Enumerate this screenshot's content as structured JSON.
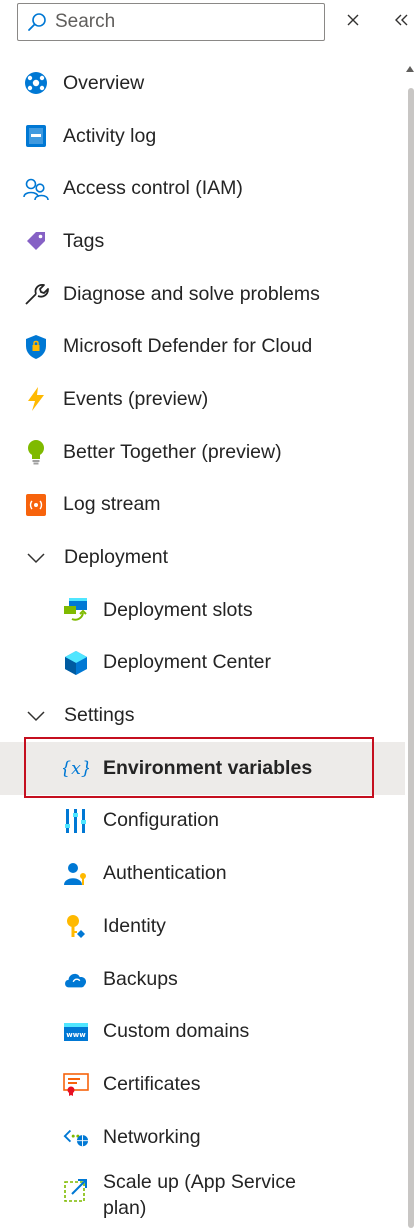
{
  "search": {
    "placeholder": "Search"
  },
  "toolbar": {
    "clear_icon": "close-icon",
    "collapse_icon": "double-chevron-left-icon"
  },
  "menu": {
    "items": [
      {
        "label": "Overview",
        "icon": "overview-icon"
      },
      {
        "label": "Activity log",
        "icon": "activity-log-icon"
      },
      {
        "label": "Access control (IAM)",
        "icon": "people-icon"
      },
      {
        "label": "Tags",
        "icon": "tag-icon"
      },
      {
        "label": "Diagnose and solve problems",
        "icon": "wrench-icon"
      },
      {
        "label": "Microsoft Defender for Cloud",
        "icon": "shield-icon"
      },
      {
        "label": "Events (preview)",
        "icon": "lightning-icon"
      },
      {
        "label": "Better Together (preview)",
        "icon": "lightbulb-icon"
      },
      {
        "label": "Log stream",
        "icon": "log-stream-icon"
      }
    ],
    "deployment": {
      "label": "Deployment",
      "items": [
        {
          "label": "Deployment slots",
          "icon": "deployment-slots-icon"
        },
        {
          "label": "Deployment Center",
          "icon": "deployment-center-icon"
        }
      ]
    },
    "settings": {
      "label": "Settings",
      "items": [
        {
          "label": "Environment variables",
          "icon": "variable-icon",
          "selected": true
        },
        {
          "label": "Configuration",
          "icon": "configuration-icon"
        },
        {
          "label": "Authentication",
          "icon": "authentication-icon"
        },
        {
          "label": "Identity",
          "icon": "identity-key-icon"
        },
        {
          "label": "Backups",
          "icon": "cloud-backup-icon"
        },
        {
          "label": "Custom domains",
          "icon": "www-icon"
        },
        {
          "label": "Certificates",
          "icon": "certificate-icon"
        },
        {
          "label": "Networking",
          "icon": "networking-icon"
        },
        {
          "label": "Scale up (App Service plan)",
          "icon": "scale-up-icon"
        }
      ]
    }
  },
  "colors": {
    "selected_bg": "#edebe9",
    "selected_outline": "#c50f1f",
    "azure_blue": "#0078d4"
  }
}
